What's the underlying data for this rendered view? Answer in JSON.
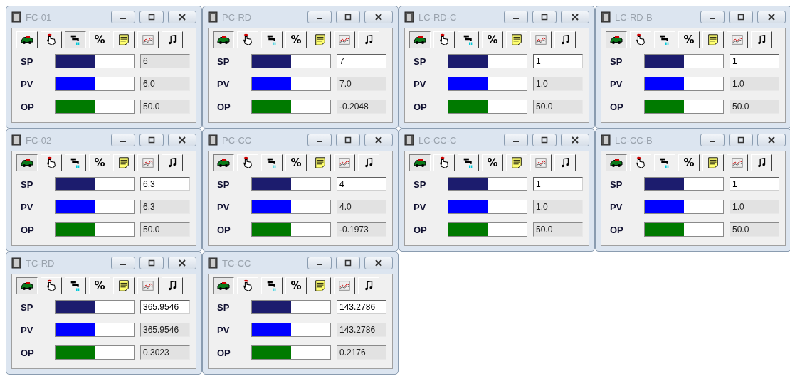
{
  "windows": [
    {
      "title": "FC-01",
      "toolbar": [
        {
          "kind": "car",
          "selected": false
        },
        {
          "kind": "hand",
          "selected": false
        },
        {
          "kind": "faucet",
          "selected": true
        },
        {
          "kind": "percent",
          "label": "%",
          "selected": false
        },
        {
          "kind": "note",
          "selected": false
        },
        {
          "kind": "trend",
          "selected": false
        },
        {
          "kind": "music",
          "selected": false
        }
      ],
      "rows": [
        {
          "label": "SP",
          "level": 0.5,
          "value": "6",
          "editable": false,
          "color": "#1c1c6e"
        },
        {
          "label": "PV",
          "level": 0.5,
          "value": "6.0",
          "editable": false,
          "color": "#0000ff"
        },
        {
          "label": "OP",
          "level": 0.5,
          "value": "50.0",
          "editable": false,
          "color": "#007a00"
        }
      ]
    },
    {
      "title": "PC-RD",
      "toolbar": [
        {
          "kind": "car",
          "selected": true
        },
        {
          "kind": "hand",
          "selected": false
        },
        {
          "kind": "faucet",
          "selected": false
        },
        {
          "kind": "percent",
          "label": "%",
          "selected": false
        },
        {
          "kind": "note",
          "selected": false
        },
        {
          "kind": "trend",
          "selected": false
        },
        {
          "kind": "music",
          "selected": false
        }
      ],
      "rows": [
        {
          "label": "SP",
          "level": 0.5,
          "value": "7",
          "editable": true,
          "color": "#1c1c6e"
        },
        {
          "label": "PV",
          "level": 0.5,
          "value": "7.0",
          "editable": false,
          "color": "#0000ff"
        },
        {
          "label": "OP",
          "level": 0.5,
          "value": "-0.2048",
          "editable": false,
          "color": "#007a00"
        }
      ]
    },
    {
      "title": "LC-RD-C",
      "toolbar": [
        {
          "kind": "car",
          "selected": true
        },
        {
          "kind": "hand",
          "selected": false
        },
        {
          "kind": "faucet",
          "selected": false
        },
        {
          "kind": "percent",
          "label": "%",
          "selected": false
        },
        {
          "kind": "note",
          "selected": false
        },
        {
          "kind": "trend",
          "selected": false
        },
        {
          "kind": "music",
          "selected": false
        }
      ],
      "rows": [
        {
          "label": "SP",
          "level": 0.5,
          "value": "1",
          "editable": true,
          "color": "#1c1c6e"
        },
        {
          "label": "PV",
          "level": 0.5,
          "value": "1.0",
          "editable": false,
          "color": "#0000ff"
        },
        {
          "label": "OP",
          "level": 0.5,
          "value": "50.0",
          "editable": false,
          "color": "#007a00"
        }
      ]
    },
    {
      "title": "LC-RD-B",
      "toolbar": [
        {
          "kind": "car",
          "selected": true
        },
        {
          "kind": "hand",
          "selected": false
        },
        {
          "kind": "faucet",
          "selected": false
        },
        {
          "kind": "percent",
          "label": "%",
          "selected": false
        },
        {
          "kind": "note",
          "selected": false
        },
        {
          "kind": "trend",
          "selected": false
        },
        {
          "kind": "music",
          "selected": false
        }
      ],
      "rows": [
        {
          "label": "SP",
          "level": 0.5,
          "value": "1",
          "editable": true,
          "color": "#1c1c6e"
        },
        {
          "label": "PV",
          "level": 0.5,
          "value": "1.0",
          "editable": false,
          "color": "#0000ff"
        },
        {
          "label": "OP",
          "level": 0.5,
          "value": "50.0",
          "editable": false,
          "color": "#007a00"
        }
      ]
    },
    {
      "title": "FC-02",
      "toolbar": [
        {
          "kind": "car",
          "selected": true
        },
        {
          "kind": "hand",
          "selected": false
        },
        {
          "kind": "faucet",
          "selected": false
        },
        {
          "kind": "percent",
          "label": "%",
          "selected": false
        },
        {
          "kind": "note",
          "selected": false
        },
        {
          "kind": "trend",
          "selected": false
        },
        {
          "kind": "music",
          "selected": false
        }
      ],
      "rows": [
        {
          "label": "SP",
          "level": 0.5,
          "value": "6.3",
          "editable": true,
          "color": "#1c1c6e"
        },
        {
          "label": "PV",
          "level": 0.5,
          "value": "6.3",
          "editable": false,
          "color": "#0000ff"
        },
        {
          "label": "OP",
          "level": 0.5,
          "value": "50.0",
          "editable": false,
          "color": "#007a00"
        }
      ]
    },
    {
      "title": "PC-CC",
      "toolbar": [
        {
          "kind": "car",
          "selected": true
        },
        {
          "kind": "hand",
          "selected": false
        },
        {
          "kind": "faucet",
          "selected": false
        },
        {
          "kind": "percent",
          "label": "%",
          "selected": false
        },
        {
          "kind": "note",
          "selected": false
        },
        {
          "kind": "trend",
          "selected": false
        },
        {
          "kind": "music",
          "selected": false
        }
      ],
      "rows": [
        {
          "label": "SP",
          "level": 0.5,
          "value": "4",
          "editable": true,
          "color": "#1c1c6e"
        },
        {
          "label": "PV",
          "level": 0.5,
          "value": "4.0",
          "editable": false,
          "color": "#0000ff"
        },
        {
          "label": "OP",
          "level": 0.5,
          "value": "-0.1973",
          "editable": false,
          "color": "#007a00"
        }
      ]
    },
    {
      "title": "LC-CC-C",
      "toolbar": [
        {
          "kind": "car",
          "selected": true
        },
        {
          "kind": "hand",
          "selected": false
        },
        {
          "kind": "faucet",
          "selected": false
        },
        {
          "kind": "percent",
          "label": "%",
          "selected": false
        },
        {
          "kind": "note",
          "selected": false
        },
        {
          "kind": "trend",
          "selected": false
        },
        {
          "kind": "music",
          "selected": false
        }
      ],
      "rows": [
        {
          "label": "SP",
          "level": 0.5,
          "value": "1",
          "editable": true,
          "color": "#1c1c6e"
        },
        {
          "label": "PV",
          "level": 0.5,
          "value": "1.0",
          "editable": false,
          "color": "#0000ff"
        },
        {
          "label": "OP",
          "level": 0.5,
          "value": "50.0",
          "editable": false,
          "color": "#007a00"
        }
      ]
    },
    {
      "title": "LC-CC-B",
      "toolbar": [
        {
          "kind": "car",
          "selected": true
        },
        {
          "kind": "hand",
          "selected": false
        },
        {
          "kind": "faucet",
          "selected": false
        },
        {
          "kind": "percent",
          "label": "%",
          "selected": false
        },
        {
          "kind": "note",
          "selected": false
        },
        {
          "kind": "trend",
          "selected": false
        },
        {
          "kind": "music",
          "selected": false
        }
      ],
      "rows": [
        {
          "label": "SP",
          "level": 0.5,
          "value": "1",
          "editable": true,
          "color": "#1c1c6e"
        },
        {
          "label": "PV",
          "level": 0.5,
          "value": "1.0",
          "editable": false,
          "color": "#0000ff"
        },
        {
          "label": "OP",
          "level": 0.5,
          "value": "50.0",
          "editable": false,
          "color": "#007a00"
        }
      ]
    },
    {
      "title": "TC-RD",
      "toolbar": [
        {
          "kind": "car",
          "selected": true
        },
        {
          "kind": "hand",
          "selected": false
        },
        {
          "kind": "faucet",
          "selected": false
        },
        {
          "kind": "percent",
          "label": "%",
          "selected": false
        },
        {
          "kind": "note",
          "selected": false
        },
        {
          "kind": "trend",
          "selected": false
        },
        {
          "kind": "music",
          "selected": false
        }
      ],
      "rows": [
        {
          "label": "SP",
          "level": 0.5,
          "value": "365.9546",
          "editable": true,
          "color": "#1c1c6e"
        },
        {
          "label": "PV",
          "level": 0.5,
          "value": "365.9546",
          "editable": false,
          "color": "#0000ff"
        },
        {
          "label": "OP",
          "level": 0.5,
          "value": "0.3023",
          "editable": false,
          "color": "#007a00"
        }
      ]
    },
    {
      "title": "TC-CC",
      "toolbar": [
        {
          "kind": "car",
          "selected": true
        },
        {
          "kind": "hand",
          "selected": false
        },
        {
          "kind": "faucet",
          "selected": false
        },
        {
          "kind": "percent",
          "label": "%",
          "selected": false
        },
        {
          "kind": "note",
          "selected": false
        },
        {
          "kind": "trend",
          "selected": false
        },
        {
          "kind": "music",
          "selected": false
        }
      ],
      "rows": [
        {
          "label": "SP",
          "level": 0.5,
          "value": "143.2786",
          "editable": true,
          "color": "#1c1c6e"
        },
        {
          "label": "PV",
          "level": 0.5,
          "value": "143.2786",
          "editable": false,
          "color": "#0000ff"
        },
        {
          "label": "OP",
          "level": 0.5,
          "value": "0.2176",
          "editable": false,
          "color": "#007a00"
        }
      ]
    }
  ]
}
